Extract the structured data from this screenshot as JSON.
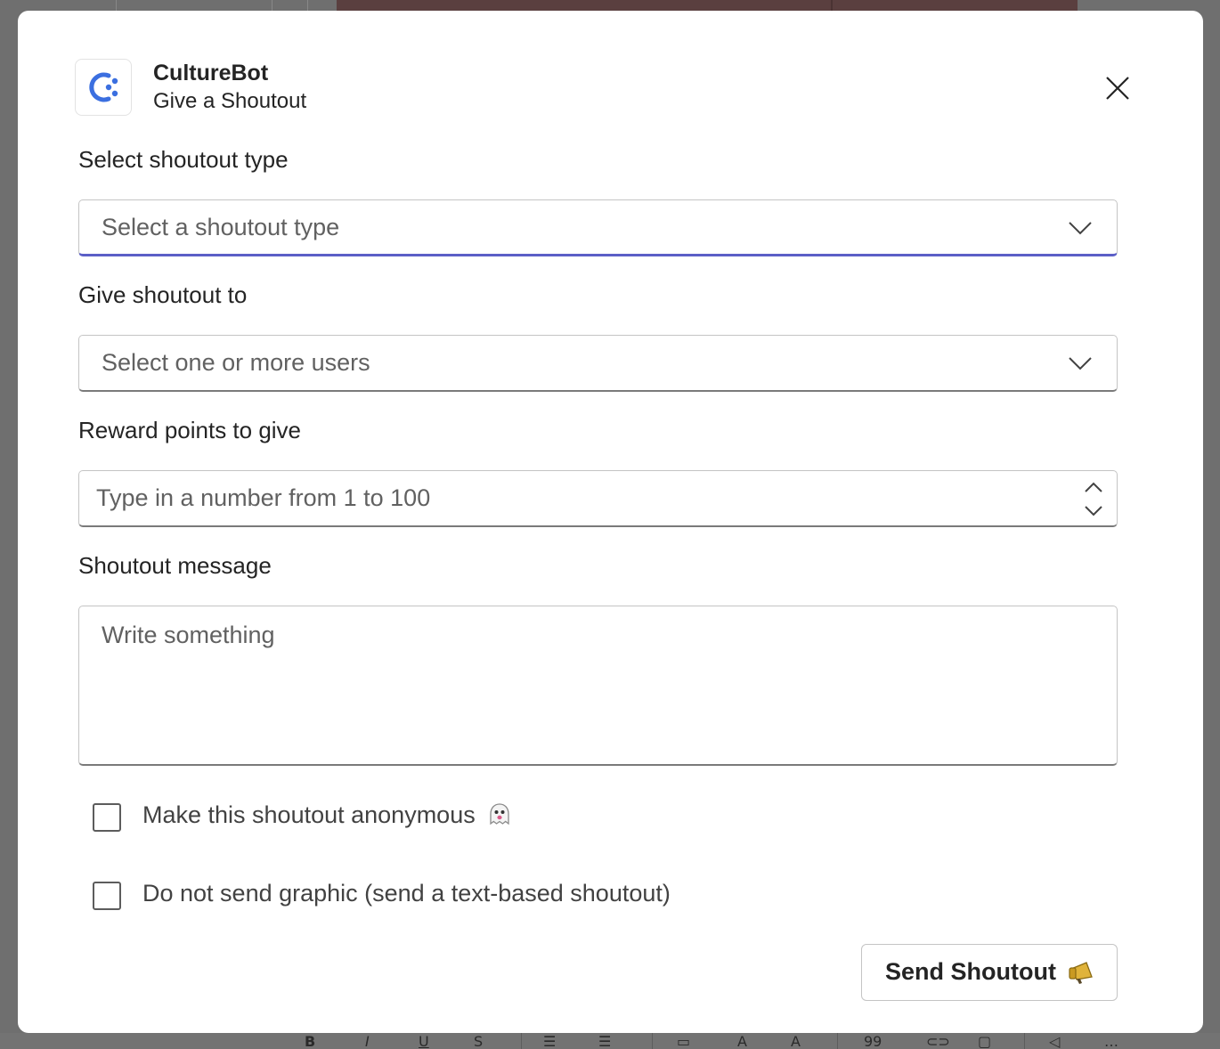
{
  "header": {
    "app_name": "CultureBot",
    "subtitle": "Give a Shoutout",
    "logo_icon": "culturebot-logo-icon",
    "close_icon": "close-icon"
  },
  "form": {
    "shoutout_type": {
      "label": "Select shoutout type",
      "placeholder": "Select a shoutout type"
    },
    "recipients": {
      "label": "Give shoutout to",
      "placeholder": "Select one or more users"
    },
    "points": {
      "label": "Reward points to give",
      "placeholder": "Type in a number from 1 to 100"
    },
    "message": {
      "label": "Shoutout message",
      "placeholder": "Write something"
    },
    "anonymous": {
      "label": "Make this shoutout anonymous",
      "icon": "ghost-icon",
      "checked": false
    },
    "no_graphic": {
      "label": "Do not send graphic (send a text-based shoutout)",
      "checked": false
    },
    "submit": {
      "label": "Send Shoutout",
      "icon": "megaphone-icon"
    }
  },
  "colors": {
    "focus_accent": "#5b5fc7",
    "logo_blue": "#3b6fe0"
  }
}
